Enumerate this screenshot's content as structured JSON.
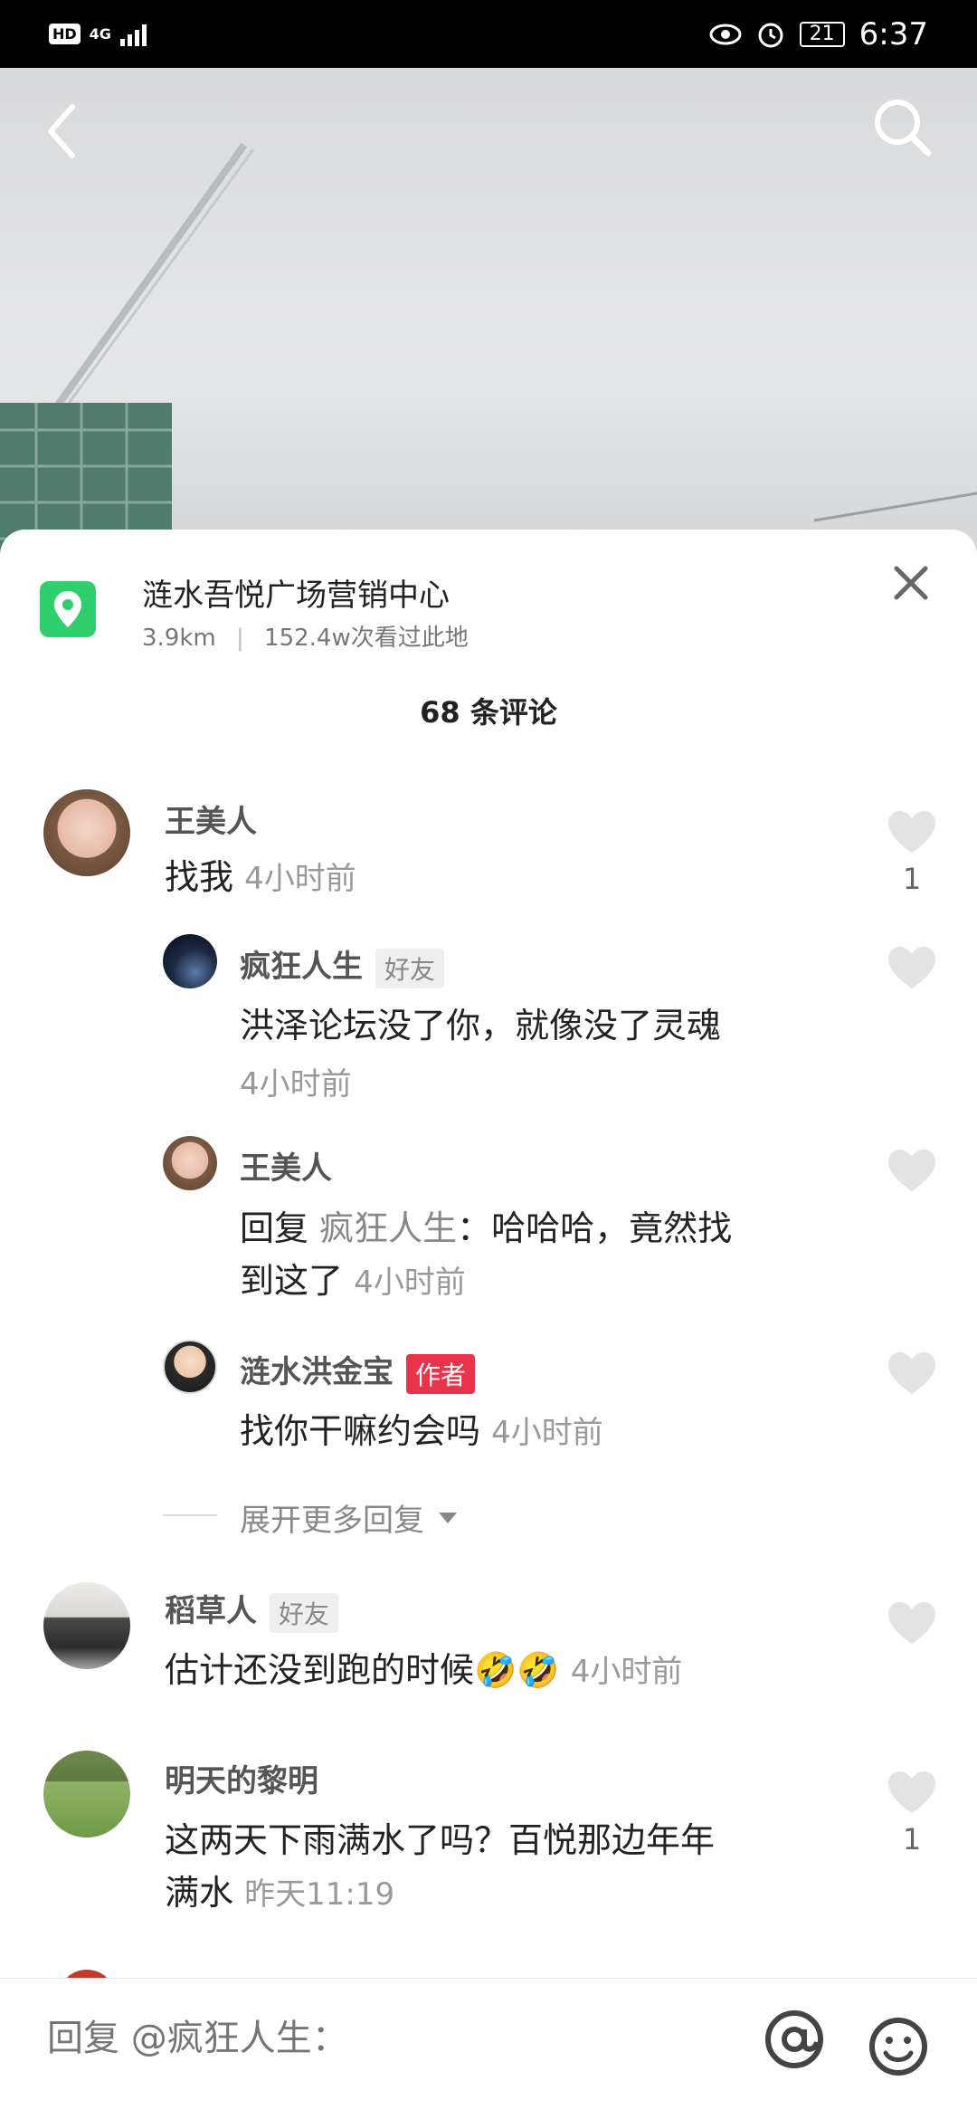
{
  "status_bar": {
    "hd": "HD",
    "network": "4G",
    "battery": "21",
    "time": "6:37"
  },
  "location": {
    "name": "涟水吾悦广场营销中心",
    "distance": "3.9km",
    "separator": "|",
    "views": "152.4w次看过此地"
  },
  "comment_count": "68 条评论",
  "comments": [
    {
      "name": "王美人",
      "text": "找我",
      "time": "4小时前",
      "likes": "1"
    },
    {
      "name": "疯狂人生",
      "tag": "好友",
      "text": "洪泽论坛没了你，就像没了灵魂",
      "time": "4小时前"
    },
    {
      "name": "王美人",
      "reply_prefix": "回复",
      "mention": "疯狂人生",
      "text_line1": "：哈哈哈，竟然找",
      "text_line2": "到这了",
      "time": "4小时前"
    },
    {
      "name": "涟水洪金宝",
      "tag": "作者",
      "text": "找你干嘛约会吗",
      "time": "4小时前"
    },
    {
      "name": "稻草人",
      "tag": "好友",
      "text": "估计还没到跑的时候",
      "emoji": "🤣🤣",
      "time": "4小时前"
    },
    {
      "name": "明天的黎明",
      "text_line1": "这两天下雨满水了吗？百悦那边年年",
      "text_line2": "满水",
      "time": "昨天11:19",
      "likes": "1"
    }
  ],
  "expand_more": "展开更多回复",
  "reply": {
    "placeholder": "回复 @疯狂人生："
  },
  "colors": {
    "green": "#2fcf6e",
    "author_tag": "#e8334a"
  }
}
